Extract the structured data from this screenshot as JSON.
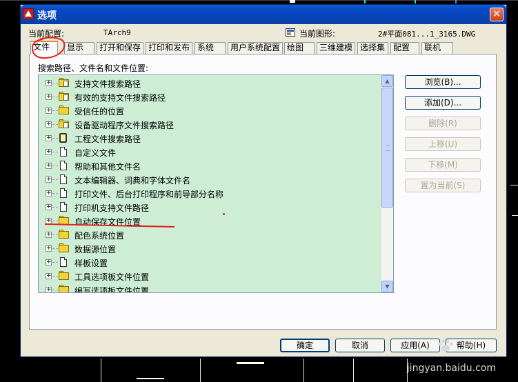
{
  "window": {
    "title": "选项"
  },
  "header": {
    "current_profile_label": "当前配置:",
    "current_profile_value": "TArch9",
    "current_drawing_label": "当前图形:",
    "current_drawing_value": "2#平面081...1_3165.DWG"
  },
  "tabs": [
    "文件",
    "显示",
    "打开和保存",
    "打印和发布",
    "系统",
    "用户系统配置",
    "绘图",
    "三维建模",
    "选择集",
    "配置",
    "联机"
  ],
  "active_tab": "文件",
  "panel": {
    "section_label": "搜索路径、文件名和文件位置:",
    "tree_items": [
      {
        "label": "支持文件搜索路径",
        "icon": "folder-icon"
      },
      {
        "label": "有效的支持文件搜索路径",
        "icon": "folder-icon"
      },
      {
        "label": "受信任的位置",
        "icon": "folder-icon"
      },
      {
        "label": "设备驱动程序文件搜索路径",
        "icon": "folder-icon"
      },
      {
        "label": "工程文件搜索路径",
        "icon": "database-icon"
      },
      {
        "label": "自定义文件",
        "icon": "file-icon"
      },
      {
        "label": "帮助和其他文件名",
        "icon": "file-icon"
      },
      {
        "label": "文本编辑器、词典和字体文件名",
        "icon": "file-icon"
      },
      {
        "label": "打印文件、后台打印程序和前导部分名称",
        "icon": "file-icon"
      },
      {
        "label": "打印机支持文件路径",
        "icon": "file-icon"
      },
      {
        "label": "自动保存文件位置",
        "icon": "folder-icon"
      },
      {
        "label": "配色系统位置",
        "icon": "folder-icon"
      },
      {
        "label": "数据源位置",
        "icon": "folder-icon"
      },
      {
        "label": "样板设置",
        "icon": "file-icon"
      },
      {
        "label": "工具选项板文件位置",
        "icon": "folder-icon"
      },
      {
        "label": "编写选项板文件位置",
        "icon": "folder-icon"
      }
    ],
    "side_buttons": {
      "browse": "浏览(B)...",
      "add": "添加(D)...",
      "remove": "删除(R)",
      "move_up": "上移(U)",
      "move_down": "下移(M)",
      "set_current": "置为当前(S)"
    }
  },
  "footer": {
    "ok": "确定",
    "cancel": "取消",
    "apply": "应用(A)",
    "help": "帮助(H)"
  },
  "watermark": "jingyan.baidu.com",
  "colors": {
    "tree_background": "#cdeed4",
    "title_bar": "#0a4bc8",
    "annotation_red": "#e02020",
    "active_tab_highlight": "#e68b2c"
  }
}
